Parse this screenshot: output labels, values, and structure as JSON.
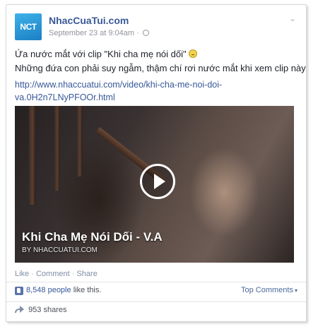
{
  "post": {
    "page_name": "NhacCuaTui.com",
    "avatar_text": "NCT",
    "timestamp": "September 23 at 9:04am",
    "meta_separator": "·",
    "text_line1": "Ứa nước mắt với clip \"Khi cha mẹ nói dối\"",
    "text_line2": "Những đứa con phải suy ngẫm, thậm chí rơi nước mắt khi xem clip này",
    "link_line1": "http://www.nhaccuatui.com/video/khi-cha-me-noi-doi-",
    "link_line2": "va.0H2n7LNyPFOOr.html"
  },
  "video": {
    "title": "Khi Cha Mẹ Nói Dối - V.A",
    "source": "BY NHACCUATUI.COM"
  },
  "actions": {
    "like": "Like",
    "comment": "Comment",
    "share": "Share",
    "separator": "·"
  },
  "engagement": {
    "likes_count": "8,548 people",
    "likes_suffix": "like this.",
    "top_comments": "Top Comments",
    "shares": "953 shares"
  },
  "colors": {
    "link": "#365899",
    "page_name": "#3b5998",
    "muted": "#90949c"
  },
  "icons": [
    "globe-icon",
    "chevron-down-icon",
    "emoji-icon",
    "play-icon",
    "thumbs-up-icon",
    "share-arrow-icon"
  ]
}
